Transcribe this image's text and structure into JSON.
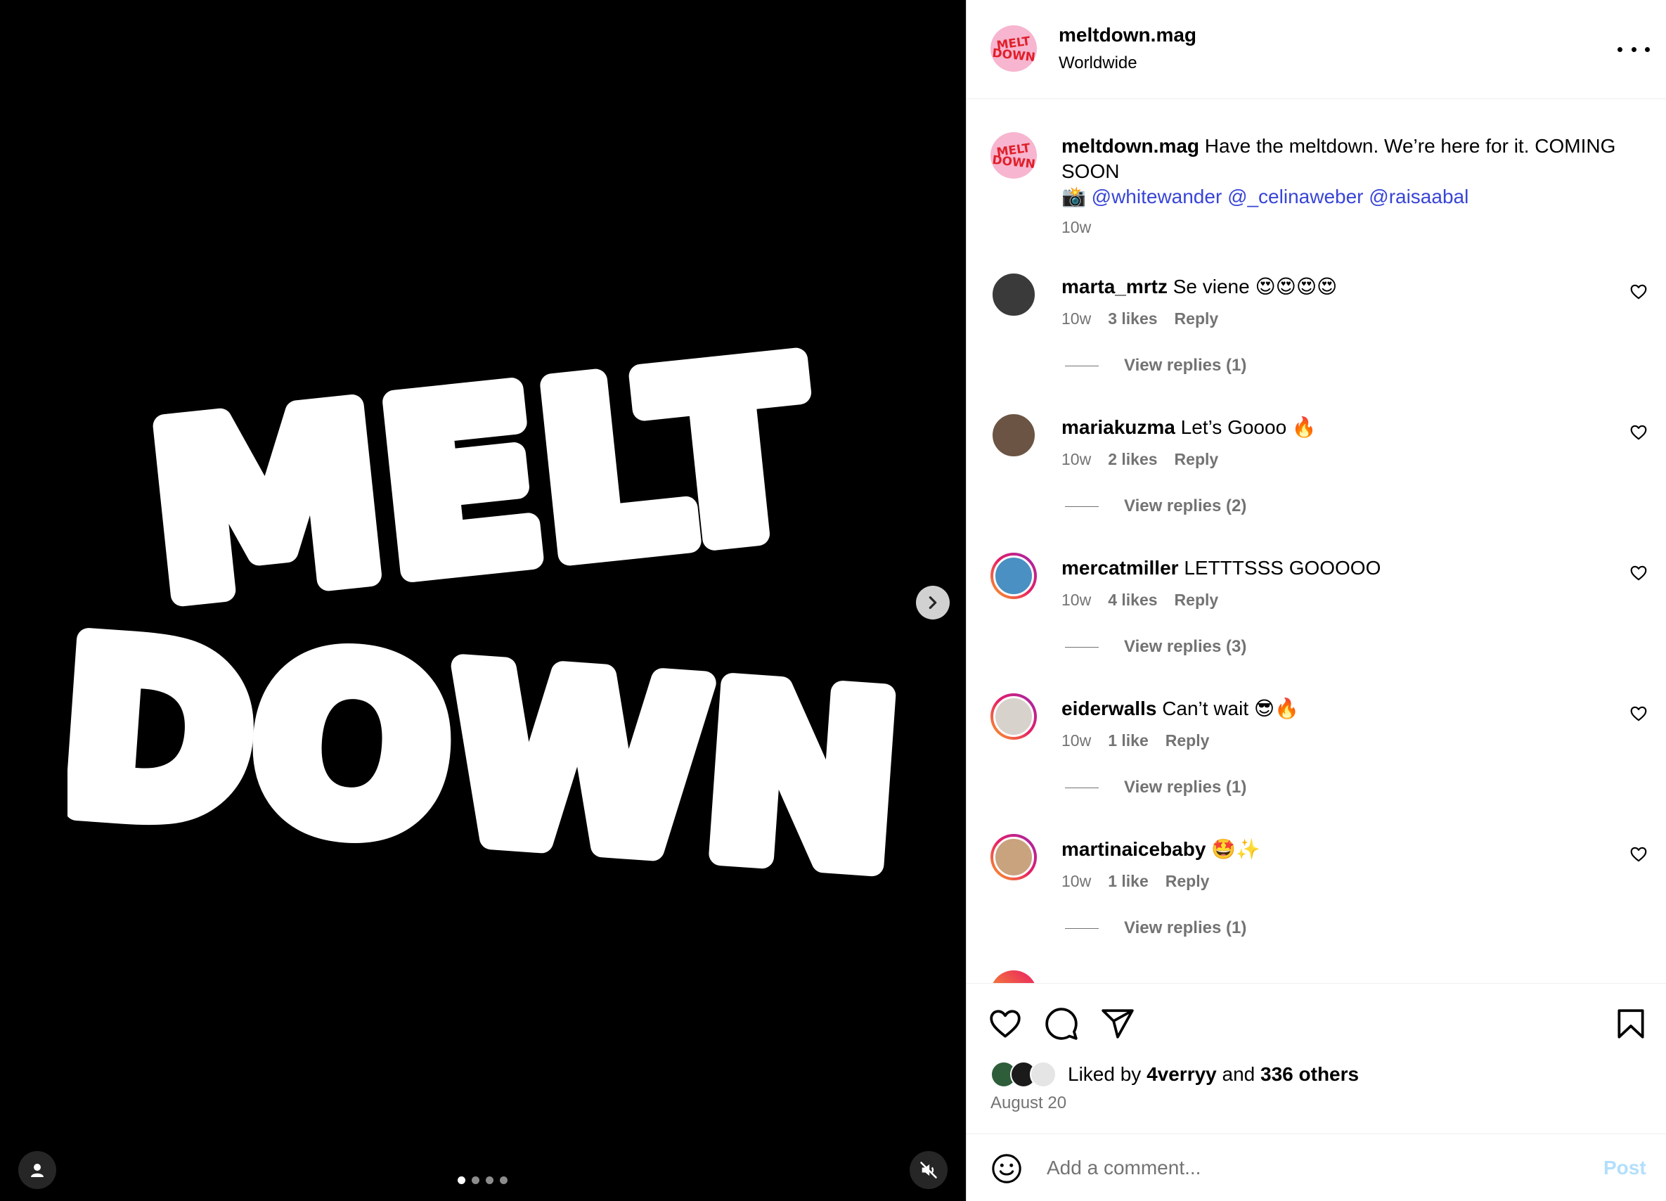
{
  "media": {
    "logo_line1": "MELT",
    "logo_line2": "DOWN",
    "carousel_count": 4,
    "carousel_active_index": 0
  },
  "header": {
    "username": "meltdown.mag",
    "location": "Worldwide",
    "avatar_text_1": "MELT",
    "avatar_text_2": "DOWN"
  },
  "caption": {
    "username": "meltdown.mag",
    "text": "Have the meltdown. We’re here for it. COMING SOON",
    "camera_emoji": "📸",
    "mentions": [
      "@whitewander",
      "@_celinaweber",
      "@raisaabal"
    ],
    "time": "10w"
  },
  "comments": [
    {
      "username": "marta_mrtz",
      "text": "Se viene 😍😍😍😍",
      "time": "10w",
      "likes": "3 likes",
      "reply": "Reply",
      "view_replies": "View replies (1)",
      "avatar_color": "#3a3a3a",
      "ring": false
    },
    {
      "username": "mariakuzma",
      "text": "Let’s Goooo 🔥",
      "time": "10w",
      "likes": "2 likes",
      "reply": "Reply",
      "view_replies": "View replies (2)",
      "avatar_color": "#6b5443",
      "ring": false
    },
    {
      "username": "mercatmiller",
      "text": "LETTTSSS GOOOOO",
      "time": "10w",
      "likes": "4 likes",
      "reply": "Reply",
      "view_replies": "View replies (3)",
      "avatar_color": "#4a90c2",
      "ring": true
    },
    {
      "username": "eiderwalls",
      "text": "Can’t wait 😎🔥",
      "time": "10w",
      "likes": "1 like",
      "reply": "Reply",
      "view_replies": "View replies (1)",
      "avatar_color": "#d8d2cc",
      "ring": true
    },
    {
      "username": "martinaicebaby",
      "text": "🤩✨",
      "time": "10w",
      "likes": "1 like",
      "reply": "Reply",
      "view_replies": "View replies (1)",
      "avatar_color": "#c9a27e",
      "ring": true
    }
  ],
  "likes": {
    "prefix": "Liked by",
    "user": "4verryy",
    "joiner": "and",
    "others": "336 others",
    "mini_avatar_colors": [
      "#2e5d3a",
      "#1a1a1a",
      "#e5e5e5"
    ]
  },
  "post_date": "August 20",
  "add_comment": {
    "placeholder": "Add a comment...",
    "post_label": "Post"
  },
  "icons": {
    "next": "chevron-right-icon",
    "user_tag": "person-icon",
    "mute": "speaker-muted-icon",
    "more": "more-horizontal-icon",
    "like": "heart-icon",
    "comment": "comment-bubble-icon",
    "share": "paper-plane-icon",
    "save": "bookmark-icon",
    "emoji": "smiley-icon"
  },
  "colors": {
    "mention": "#3845d6",
    "meta": "#737373",
    "post_button": "#b2dffc",
    "brand_pink": "#f7b5cf",
    "brand_red": "#e0202a"
  }
}
